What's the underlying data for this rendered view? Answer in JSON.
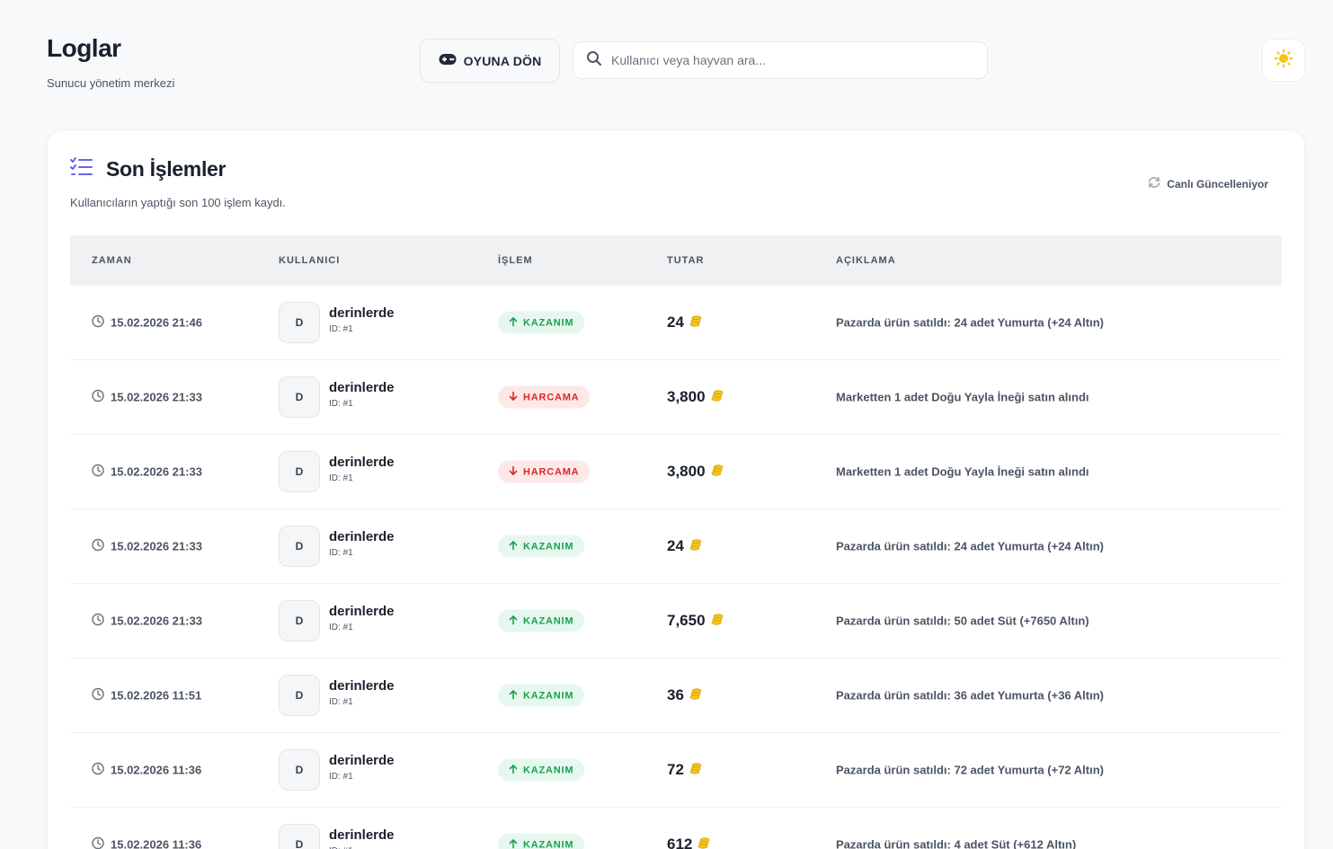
{
  "header": {
    "title": "Loglar",
    "subtitle": "Sunucu yönetim merkezi",
    "back_button": "OYUNA DÖN",
    "search_placeholder": "Kullanıcı veya hayvan ara..."
  },
  "card": {
    "title": "Son İşlemler",
    "description": "Kullanıcıların yaptığı son 100 işlem kaydı.",
    "live_status": "Canlı Güncelleniyor"
  },
  "table": {
    "columns": [
      "ZAMAN",
      "KULLANICI",
      "İŞLEM",
      "TUTAR",
      "AÇIKLAMA"
    ],
    "rows": [
      {
        "time": "15.02.2026 21:46",
        "avatar": "D",
        "user": "derinlerde",
        "uid": "ID: #1",
        "type": "gain",
        "op": "KAZANIM",
        "amount": "24",
        "desc": "Pazarda ürün satıldı: 24 adet Yumurta (+24 Altın)"
      },
      {
        "time": "15.02.2026 21:33",
        "avatar": "D",
        "user": "derinlerde",
        "uid": "ID: #1",
        "type": "spend",
        "op": "HARCAMA",
        "amount": "3,800",
        "desc": "Marketten 1 adet Doğu Yayla İneği satın alındı"
      },
      {
        "time": "15.02.2026 21:33",
        "avatar": "D",
        "user": "derinlerde",
        "uid": "ID: #1",
        "type": "spend",
        "op": "HARCAMA",
        "amount": "3,800",
        "desc": "Marketten 1 adet Doğu Yayla İneği satın alındı"
      },
      {
        "time": "15.02.2026 21:33",
        "avatar": "D",
        "user": "derinlerde",
        "uid": "ID: #1",
        "type": "gain",
        "op": "KAZANIM",
        "amount": "24",
        "desc": "Pazarda ürün satıldı: 24 adet Yumurta (+24 Altın)"
      },
      {
        "time": "15.02.2026 21:33",
        "avatar": "D",
        "user": "derinlerde",
        "uid": "ID: #1",
        "type": "gain",
        "op": "KAZANIM",
        "amount": "7,650",
        "desc": "Pazarda ürün satıldı: 50 adet Süt (+7650 Altın)"
      },
      {
        "time": "15.02.2026 11:51",
        "avatar": "D",
        "user": "derinlerde",
        "uid": "ID: #1",
        "type": "gain",
        "op": "KAZANIM",
        "amount": "36",
        "desc": "Pazarda ürün satıldı: 36 adet Yumurta (+36 Altın)"
      },
      {
        "time": "15.02.2026 11:36",
        "avatar": "D",
        "user": "derinlerde",
        "uid": "ID: #1",
        "type": "gain",
        "op": "KAZANIM",
        "amount": "72",
        "desc": "Pazarda ürün satıldı: 72 adet Yumurta (+72 Altın)"
      },
      {
        "time": "15.02.2026 11:36",
        "avatar": "D",
        "user": "derinlerde",
        "uid": "ID: #1",
        "type": "gain",
        "op": "KAZANIM",
        "amount": "612",
        "desc": "Pazarda ürün satıldı: 4 adet Süt (+612 Altın)"
      }
    ]
  },
  "colors": {
    "gain": "#16a34a",
    "spend": "#dc2626",
    "accent": "#6366f1",
    "coin": "#f5c518"
  },
  "icons": {
    "back_button": "gamepad-icon",
    "search": "search-icon",
    "theme": "sun-icon",
    "card_title": "list-check-icon",
    "live": "refresh-icon",
    "time": "clock-icon",
    "gain": "arrow-up-icon",
    "spend": "arrow-down-icon",
    "amount": "coins-icon"
  }
}
